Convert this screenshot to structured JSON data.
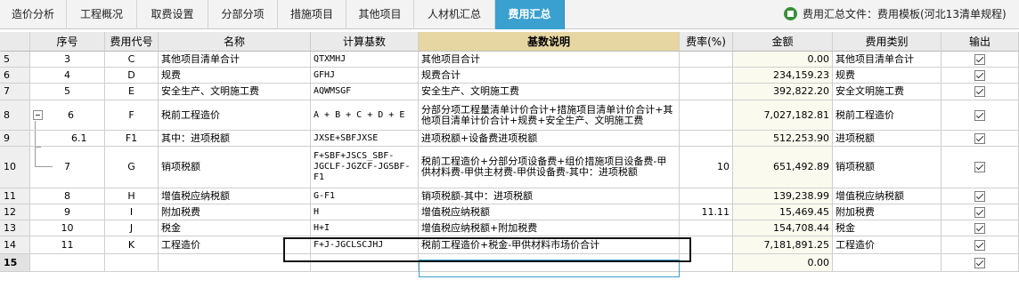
{
  "tabs": [
    {
      "label": "造价分析",
      "active": false
    },
    {
      "label": "工程概况",
      "active": false
    },
    {
      "label": "取费设置",
      "active": false
    },
    {
      "label": "分部分项",
      "active": false
    },
    {
      "label": "措施项目",
      "active": false
    },
    {
      "label": "其他项目",
      "active": false
    },
    {
      "label": "人材机汇总",
      "active": false
    },
    {
      "label": "费用汇总",
      "active": true
    }
  ],
  "file_label": "费用汇总文件：费用模板(河北13清单规程)",
  "columns": {
    "seq": "序号",
    "code": "费用代号",
    "name": "名称",
    "basis": "计算基数",
    "basis_desc": "基数说明",
    "rate": "费率(%)",
    "amount": "金额",
    "category": "费用类别",
    "output": "输出"
  },
  "rows": [
    {
      "rownum": "5",
      "seq": "3",
      "code": "C",
      "name": "其他项目清单合计",
      "basis": "QTXMHJ",
      "basis_desc": "其他项目合计",
      "rate": "",
      "amount": "0.00",
      "category": "其他项目清单合计",
      "output": true
    },
    {
      "rownum": "6",
      "seq": "4",
      "code": "D",
      "name": "规费",
      "basis": "GFHJ",
      "basis_desc": "规费合计",
      "rate": "",
      "amount": "234,159.23",
      "category": "规费",
      "output": true
    },
    {
      "rownum": "7",
      "seq": "5",
      "code": "E",
      "name": "安全生产、文明施工费",
      "basis": "AQWMSGF",
      "basis_desc": "安全生产、文明施工费",
      "rate": "",
      "amount": "392,822.20",
      "category": "安全文明施工费",
      "output": true
    },
    {
      "rownum": "8",
      "seq": "6",
      "code": "F",
      "name": "税前工程造价",
      "basis": "A + B + C + D + E",
      "basis_desc": "分部分项工程量清单计价合计+措施项目清单计价合计+其他项目清单计价合计+规费+安全生产、文明施工费",
      "rate": "",
      "amount": "7,027,182.81",
      "category": "税前工程造价",
      "output": true
    },
    {
      "rownum": "9",
      "seq": "6.1",
      "code": "F1",
      "name": "其中：进项税额",
      "basis": "JXSE+SBFJXSE",
      "basis_desc": "进项税额+设备费进项税额",
      "rate": "",
      "amount": "512,253.90",
      "category": "进项税额",
      "output": true
    },
    {
      "rownum": "10",
      "seq": "7",
      "code": "G",
      "name": "销项税额",
      "basis": "F+SBF+JSCS_SBF-JGCLF-JGZCF-JGSBF-F1",
      "basis_desc": "税前工程造价+分部分项设备费+组价措施项目设备费-甲供材料费-甲供主材费-甲供设备费-其中：进项税额",
      "rate": "10",
      "amount": "651,492.89",
      "category": "销项税额",
      "output": true
    },
    {
      "rownum": "11",
      "seq": "8",
      "code": "H",
      "name": "增值税应纳税额",
      "basis": "G-F1",
      "basis_desc": "销项税额-其中：进项税额",
      "rate": "",
      "amount": "139,238.99",
      "category": "增值税应纳税额",
      "output": true
    },
    {
      "rownum": "12",
      "seq": "9",
      "code": "I",
      "name": "附加税费",
      "basis": "H",
      "basis_desc": "增值税应纳税额",
      "rate": "11.11",
      "amount": "15,469.45",
      "category": "附加税费",
      "output": true
    },
    {
      "rownum": "13",
      "seq": "10",
      "code": "J",
      "name": "税金",
      "basis": "H+I",
      "basis_desc": "增值税应纳税额+附加税费",
      "rate": "",
      "amount": "154,708.44",
      "category": "税金",
      "output": true
    },
    {
      "rownum": "14",
      "seq": "11",
      "code": "K",
      "name": "工程造价",
      "basis": "F+J-JGCLSCJHJ",
      "basis_desc": "税前工程造价+税金-甲供材料市场价合计",
      "rate": "",
      "amount": "7,181,891.25",
      "category": "工程造价",
      "output": true
    },
    {
      "rownum": "15",
      "seq": "",
      "code": "",
      "name": "",
      "basis": "",
      "basis_desc": "",
      "rate": "",
      "amount": "0.00",
      "category": "",
      "output": true
    }
  ]
}
